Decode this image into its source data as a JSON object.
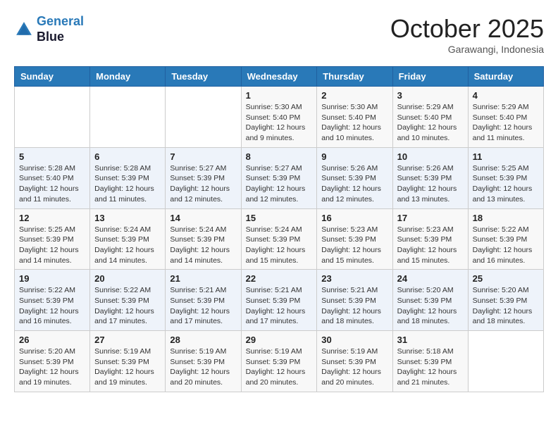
{
  "header": {
    "logo_line1": "General",
    "logo_line2": "Blue",
    "month": "October 2025",
    "location": "Garawangi, Indonesia"
  },
  "weekdays": [
    "Sunday",
    "Monday",
    "Tuesday",
    "Wednesday",
    "Thursday",
    "Friday",
    "Saturday"
  ],
  "weeks": [
    [
      {
        "day": "",
        "info": ""
      },
      {
        "day": "",
        "info": ""
      },
      {
        "day": "",
        "info": ""
      },
      {
        "day": "1",
        "info": "Sunrise: 5:30 AM\nSunset: 5:40 PM\nDaylight: 12 hours\nand 9 minutes."
      },
      {
        "day": "2",
        "info": "Sunrise: 5:30 AM\nSunset: 5:40 PM\nDaylight: 12 hours\nand 10 minutes."
      },
      {
        "day": "3",
        "info": "Sunrise: 5:29 AM\nSunset: 5:40 PM\nDaylight: 12 hours\nand 10 minutes."
      },
      {
        "day": "4",
        "info": "Sunrise: 5:29 AM\nSunset: 5:40 PM\nDaylight: 12 hours\nand 11 minutes."
      }
    ],
    [
      {
        "day": "5",
        "info": "Sunrise: 5:28 AM\nSunset: 5:40 PM\nDaylight: 12 hours\nand 11 minutes."
      },
      {
        "day": "6",
        "info": "Sunrise: 5:28 AM\nSunset: 5:39 PM\nDaylight: 12 hours\nand 11 minutes."
      },
      {
        "day": "7",
        "info": "Sunrise: 5:27 AM\nSunset: 5:39 PM\nDaylight: 12 hours\nand 12 minutes."
      },
      {
        "day": "8",
        "info": "Sunrise: 5:27 AM\nSunset: 5:39 PM\nDaylight: 12 hours\nand 12 minutes."
      },
      {
        "day": "9",
        "info": "Sunrise: 5:26 AM\nSunset: 5:39 PM\nDaylight: 12 hours\nand 12 minutes."
      },
      {
        "day": "10",
        "info": "Sunrise: 5:26 AM\nSunset: 5:39 PM\nDaylight: 12 hours\nand 13 minutes."
      },
      {
        "day": "11",
        "info": "Sunrise: 5:25 AM\nSunset: 5:39 PM\nDaylight: 12 hours\nand 13 minutes."
      }
    ],
    [
      {
        "day": "12",
        "info": "Sunrise: 5:25 AM\nSunset: 5:39 PM\nDaylight: 12 hours\nand 14 minutes."
      },
      {
        "day": "13",
        "info": "Sunrise: 5:24 AM\nSunset: 5:39 PM\nDaylight: 12 hours\nand 14 minutes."
      },
      {
        "day": "14",
        "info": "Sunrise: 5:24 AM\nSunset: 5:39 PM\nDaylight: 12 hours\nand 14 minutes."
      },
      {
        "day": "15",
        "info": "Sunrise: 5:24 AM\nSunset: 5:39 PM\nDaylight: 12 hours\nand 15 minutes."
      },
      {
        "day": "16",
        "info": "Sunrise: 5:23 AM\nSunset: 5:39 PM\nDaylight: 12 hours\nand 15 minutes."
      },
      {
        "day": "17",
        "info": "Sunrise: 5:23 AM\nSunset: 5:39 PM\nDaylight: 12 hours\nand 15 minutes."
      },
      {
        "day": "18",
        "info": "Sunrise: 5:22 AM\nSunset: 5:39 PM\nDaylight: 12 hours\nand 16 minutes."
      }
    ],
    [
      {
        "day": "19",
        "info": "Sunrise: 5:22 AM\nSunset: 5:39 PM\nDaylight: 12 hours\nand 16 minutes."
      },
      {
        "day": "20",
        "info": "Sunrise: 5:22 AM\nSunset: 5:39 PM\nDaylight: 12 hours\nand 17 minutes."
      },
      {
        "day": "21",
        "info": "Sunrise: 5:21 AM\nSunset: 5:39 PM\nDaylight: 12 hours\nand 17 minutes."
      },
      {
        "day": "22",
        "info": "Sunrise: 5:21 AM\nSunset: 5:39 PM\nDaylight: 12 hours\nand 17 minutes."
      },
      {
        "day": "23",
        "info": "Sunrise: 5:21 AM\nSunset: 5:39 PM\nDaylight: 12 hours\nand 18 minutes."
      },
      {
        "day": "24",
        "info": "Sunrise: 5:20 AM\nSunset: 5:39 PM\nDaylight: 12 hours\nand 18 minutes."
      },
      {
        "day": "25",
        "info": "Sunrise: 5:20 AM\nSunset: 5:39 PM\nDaylight: 12 hours\nand 18 minutes."
      }
    ],
    [
      {
        "day": "26",
        "info": "Sunrise: 5:20 AM\nSunset: 5:39 PM\nDaylight: 12 hours\nand 19 minutes."
      },
      {
        "day": "27",
        "info": "Sunrise: 5:19 AM\nSunset: 5:39 PM\nDaylight: 12 hours\nand 19 minutes."
      },
      {
        "day": "28",
        "info": "Sunrise: 5:19 AM\nSunset: 5:39 PM\nDaylight: 12 hours\nand 20 minutes."
      },
      {
        "day": "29",
        "info": "Sunrise: 5:19 AM\nSunset: 5:39 PM\nDaylight: 12 hours\nand 20 minutes."
      },
      {
        "day": "30",
        "info": "Sunrise: 5:19 AM\nSunset: 5:39 PM\nDaylight: 12 hours\nand 20 minutes."
      },
      {
        "day": "31",
        "info": "Sunrise: 5:18 AM\nSunset: 5:39 PM\nDaylight: 12 hours\nand 21 minutes."
      },
      {
        "day": "",
        "info": ""
      }
    ]
  ]
}
